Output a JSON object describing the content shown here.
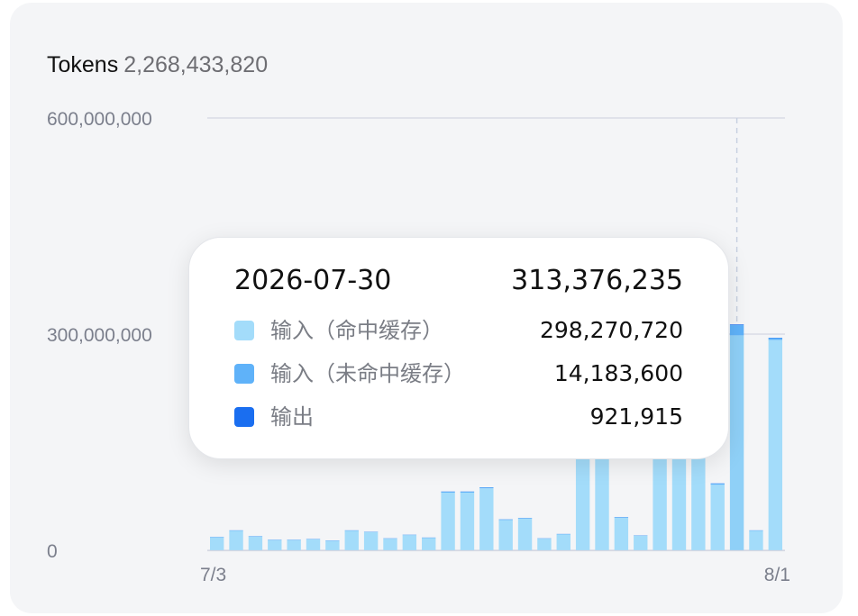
{
  "header": {
    "title": "Tokens",
    "total": "2,268,433,820"
  },
  "chart_data": {
    "type": "bar",
    "stacked": true,
    "title": "",
    "xlabel": "",
    "ylabel": "",
    "ylim": [
      0,
      600000000
    ],
    "y_ticks": [
      "600,000,000",
      "300,000,000",
      "0"
    ],
    "x_tick_labels": [
      "7/3",
      "8/1"
    ],
    "grid": true,
    "categories": [
      "7/3",
      "7/4",
      "7/5",
      "7/6",
      "7/7",
      "7/8",
      "7/9",
      "7/10",
      "7/11",
      "7/12",
      "7/13",
      "7/14",
      "7/15",
      "7/16",
      "7/17",
      "7/18",
      "7/19",
      "7/20",
      "7/21",
      "7/22",
      "7/23",
      "7/24",
      "7/25",
      "7/26",
      "7/27",
      "7/28",
      "7/29",
      "7/30",
      "7/31",
      "8/1"
    ],
    "series": [
      {
        "name": "输入（命中缓存）",
        "color": "#a3dcfa",
        "values": [
          18000000,
          27000000,
          19000000,
          14000000,
          14000000,
          15000000,
          13000000,
          27000000,
          25000000,
          16000000,
          21000000,
          17000000,
          80000000,
          80000000,
          86000000,
          42000000,
          44000000,
          16000000,
          22000000,
          250000000,
          250000000,
          45000000,
          20000000,
          250000000,
          250000000,
          130000000,
          91000000,
          298270720,
          27000000,
          292000000
        ]
      },
      {
        "name": "输入（未命中缓存）",
        "color": "#5fb2f9",
        "values": [
          500000,
          500000,
          500000,
          500000,
          500000,
          500000,
          500000,
          500000,
          500000,
          500000,
          500000,
          500000,
          1200000,
          1200000,
          1200000,
          800000,
          800000,
          500000,
          500000,
          1500000,
          1500000,
          800000,
          500000,
          4000000,
          4000000,
          1500000,
          1500000,
          14183600,
          500000,
          2500000
        ]
      },
      {
        "name": "输出",
        "color": "#1a6ef0",
        "values": [
          150000,
          150000,
          150000,
          150000,
          150000,
          150000,
          150000,
          150000,
          150000,
          150000,
          150000,
          150000,
          300000,
          300000,
          300000,
          200000,
          200000,
          150000,
          150000,
          400000,
          400000,
          200000,
          150000,
          600000,
          600000,
          300000,
          300000,
          921915,
          150000,
          500000
        ]
      }
    ],
    "tooltip": {
      "date": "2026-07-30",
      "total": "313,376,235",
      "rows": [
        {
          "label": "输入（命中缓存）",
          "value": "298,270,720",
          "color": "#a3dcfa"
        },
        {
          "label": "输入（未命中缓存）",
          "value": "14,183,600",
          "color": "#5fb2f9"
        },
        {
          "label": "输出",
          "value": "921,915",
          "color": "#1a6ef0"
        }
      ]
    },
    "highlight_index": 27
  }
}
